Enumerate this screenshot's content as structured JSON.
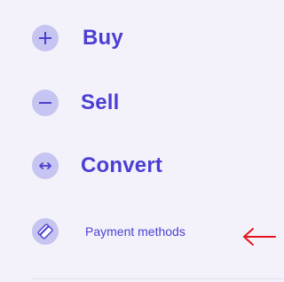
{
  "menu": {
    "items": [
      {
        "label": "Buy",
        "icon": "plus-icon"
      },
      {
        "label": "Sell",
        "icon": "minus-icon"
      },
      {
        "label": "Convert",
        "icon": "convert-arrows-icon"
      },
      {
        "label": "Payment methods",
        "icon": "payment-card-icon"
      }
    ]
  },
  "colors": {
    "background": "#f3f2fa",
    "accent": "#4b3fd3",
    "icon_bg": "#c6c4f0",
    "annotation": "#e4141b"
  }
}
